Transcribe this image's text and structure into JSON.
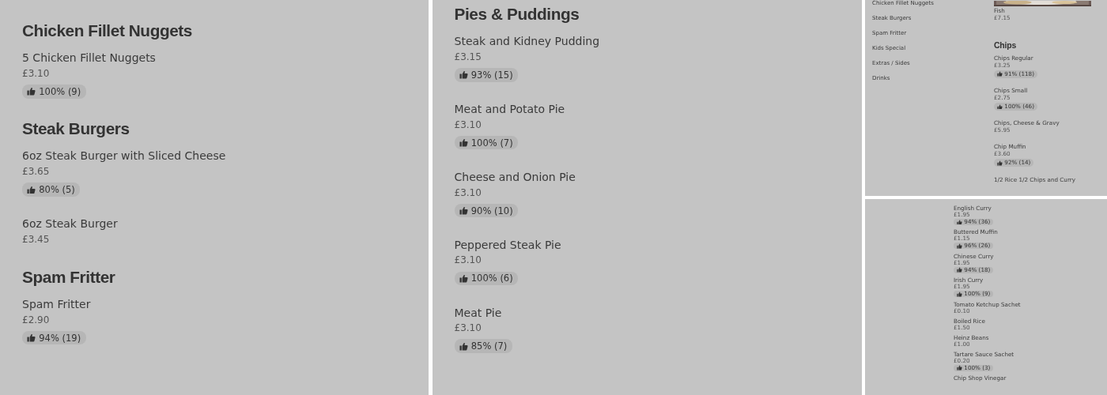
{
  "panels": [
    {
      "kind": "page",
      "sections": [
        {
          "title": "Chicken Fillet Nuggets",
          "items": [
            {
              "name": "5 Chicken Fillet Nuggets",
              "price": "£3.10",
              "rating": "100% (9)"
            }
          ]
        },
        {
          "title": "Steak Burgers",
          "items": [
            {
              "name": "6oz Steak Burger with Sliced Cheese",
              "price": "£3.65",
              "rating": "80% (5)"
            },
            {
              "name": "6oz Steak Burger",
              "price": "£3.45"
            }
          ]
        },
        {
          "title": "Spam Fritter",
          "items": [
            {
              "name": "Spam Fritter",
              "price": "£2.90",
              "rating": "94% (19)"
            }
          ]
        }
      ]
    },
    {
      "kind": "page",
      "sections": [
        {
          "title": "Pies & Puddings",
          "items": [
            {
              "name": "Steak and Kidney Pudding",
              "price": "£3.15",
              "rating": "93% (15)"
            },
            {
              "name": "Meat and Potato Pie",
              "price": "£3.10",
              "rating": "100% (7)"
            },
            {
              "name": "Cheese and Onion Pie",
              "price": "£3.10",
              "rating": "90% (10)"
            },
            {
              "name": "Peppered Steak Pie",
              "price": "£3.10",
              "rating": "100% (6)"
            },
            {
              "name": "Meat Pie",
              "price": "£3.10",
              "rating": "85% (7)"
            }
          ]
        }
      ]
    },
    {
      "kind": "compact",
      "sidebar": [
        "Chicken Fillet Nuggets",
        "Steak Burgers",
        "Spam Fritter",
        "Kids Special",
        "Extras / Sides",
        "Drinks"
      ],
      "top_picture": {
        "kind": "picture"
      },
      "sections": [
        {
          "items": [
            {
              "name": "Fish",
              "price": "£7.15"
            }
          ]
        },
        {
          "title": "Chips",
          "items": [
            {
              "name": "Chips Regular",
              "price": "£3.25",
              "rating": "91% (118)"
            },
            {
              "name": "Chips Small",
              "price": "£2.75",
              "rating": "100% (46)"
            },
            {
              "name": "Chips, Cheese & Gravy",
              "price": "£5.95"
            },
            {
              "name": "Chip Muffin",
              "price": "£3.60",
              "rating": "92% (14)"
            },
            {
              "name": "1/2 Rice 1/2 Chips and Curry"
            }
          ]
        }
      ]
    },
    {
      "kind": "mini",
      "sections": [
        {
          "items": [
            {
              "name": "English Curry",
              "price": "£1.95",
              "rating": "94% (36)"
            },
            {
              "name": "Buttered Muffin",
              "price": "£1.15",
              "rating": "96% (26)"
            },
            {
              "name": "Chinese Curry",
              "price": "£1.95",
              "rating": "94% (18)"
            },
            {
              "name": "Irish Curry",
              "price": "£1.95",
              "rating": "100% (9)"
            },
            {
              "name": "Tomato Ketchup Sachet",
              "price": "£0.10"
            },
            {
              "name": "Boiled Rice",
              "price": "£1.50"
            },
            {
              "name": "Heinz Beans",
              "price": "£1.00"
            },
            {
              "name": "Tartare Sauce Sachet",
              "price": "£0.20",
              "rating": "100% (3)"
            },
            {
              "name": "Chip Shop Vinegar"
            }
          ]
        }
      ]
    }
  ]
}
